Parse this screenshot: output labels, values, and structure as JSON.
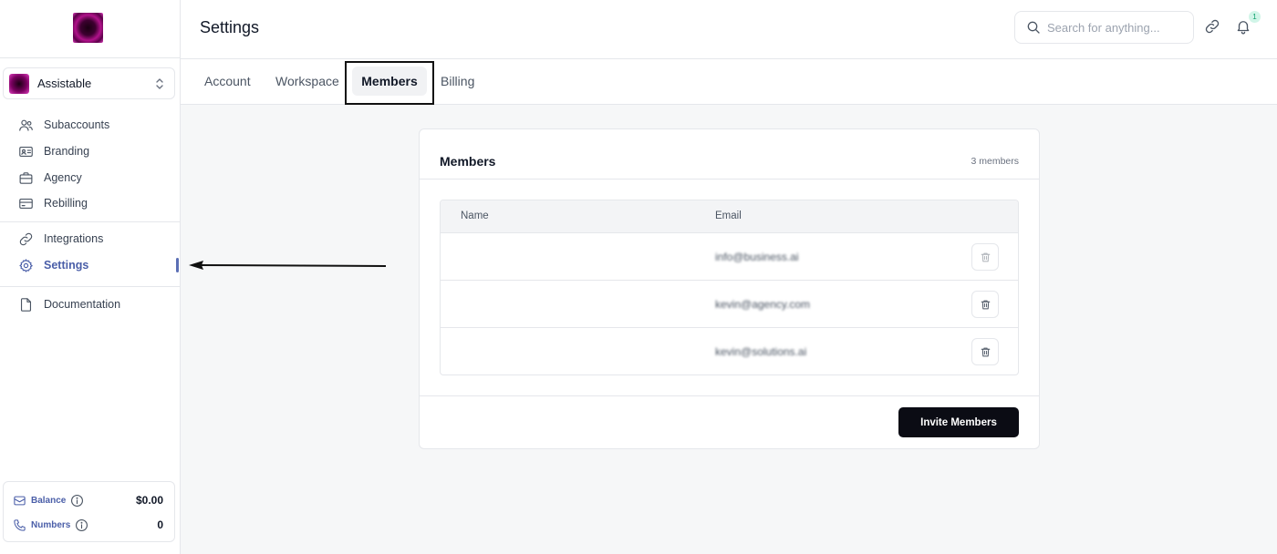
{
  "header": {
    "title": "Settings",
    "search_placeholder": "Search for anything...",
    "notification_count": "1"
  },
  "sidebar": {
    "account_name": "Assistable",
    "groups": [
      [
        {
          "label": "Subaccounts",
          "icon": "users-icon"
        },
        {
          "label": "Branding",
          "icon": "id-card-icon"
        },
        {
          "label": "Agency",
          "icon": "briefcase-icon"
        },
        {
          "label": "Rebilling",
          "icon": "credit-card-icon"
        }
      ],
      [
        {
          "label": "Integrations",
          "icon": "link-icon"
        },
        {
          "label": "Settings",
          "icon": "gear-icon",
          "active": true
        }
      ],
      [
        {
          "label": "Documentation",
          "icon": "document-icon"
        }
      ]
    ],
    "balance": {
      "label": "Balance",
      "value": "$0.00"
    },
    "numbers": {
      "label": "Numbers",
      "value": "0"
    }
  },
  "tabs": [
    {
      "label": "Account"
    },
    {
      "label": "Workspace"
    },
    {
      "label": "Members",
      "active": true
    },
    {
      "label": "Billing"
    }
  ],
  "members_card": {
    "title": "Members",
    "count": "3 members",
    "columns": [
      "Name",
      "Email"
    ],
    "rows": [
      {
        "name": "",
        "email": "info@business.ai"
      },
      {
        "name": "",
        "email": "kevin@agency.com"
      },
      {
        "name": "",
        "email": "kevin@solutions.ai"
      }
    ],
    "invite_label": "Invite Members"
  },
  "colors": {
    "accent": "#4a5ea8",
    "primary_button": "#0b0c14",
    "border": "#e5e7eb"
  }
}
